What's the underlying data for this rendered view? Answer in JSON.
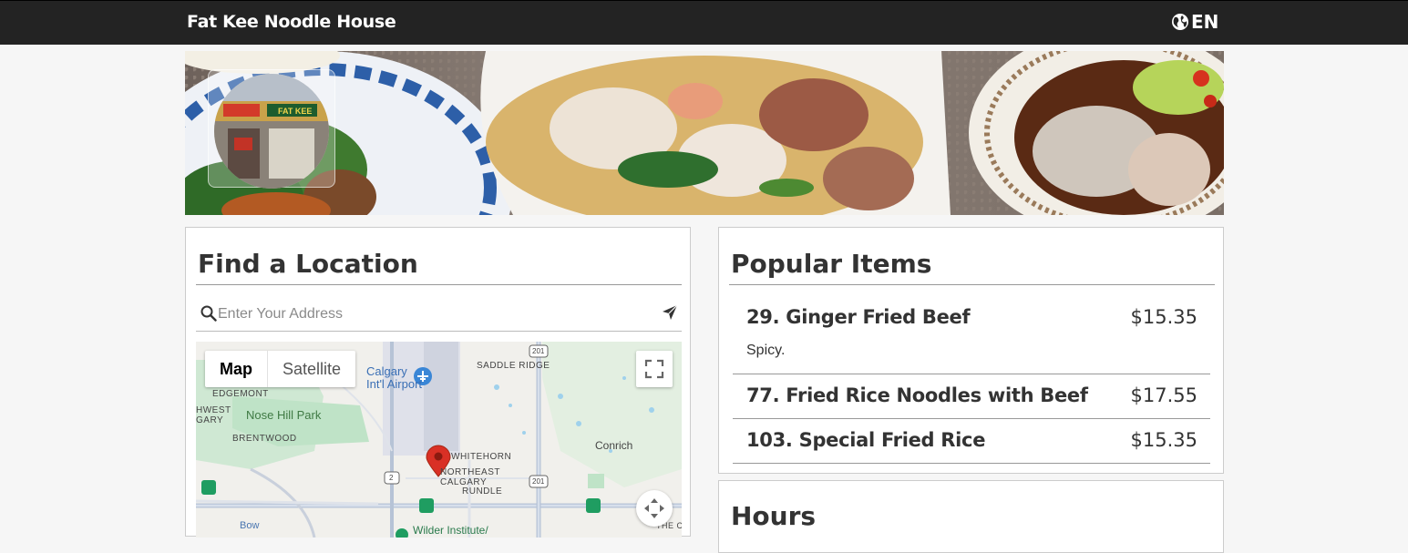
{
  "header": {
    "brand": "Fat Kee Noodle House",
    "language": "EN",
    "language_icon": "globe-icon"
  },
  "banner": {
    "logo_sign_text": "FAT KEE"
  },
  "find_location": {
    "title": "Find a Location",
    "search_placeholder": "Enter Your Address",
    "search_icon": "search-icon",
    "locate_icon": "paper-plane-icon",
    "map": {
      "type_buttons": [
        "Map",
        "Satellite"
      ],
      "selected_type": "Map",
      "labels": {
        "calgary_airport": "Calgary\nInt'l Airport",
        "saddle_ridge": "SADDLE RIDGE",
        "edgemont": "EDGEMONT",
        "hwest": "HWEST\nGARY",
        "nose_hill": "Nose Hill Park",
        "brentwood": "BRENTWOOD",
        "whitehorn": "WHITEHORN",
        "northeast": "NORTHEAST\nCALGARY",
        "rundle": "RUNDLE",
        "conrich": "Conrich",
        "hwy201_top": "201",
        "hwy201_mid": "201",
        "hwy2": "2",
        "wilder": "Wilder Institute/",
        "bottom_left": "Bow",
        "bottom_right": "THE C"
      }
    }
  },
  "popular_items": {
    "title": "Popular Items",
    "items": [
      {
        "name": "29. Ginger Fried Beef",
        "price": "$15.35",
        "description": "Spicy."
      },
      {
        "name": "77. Fried Rice Noodles with Beef",
        "price": "$17.55"
      },
      {
        "name": "103. Special Fried Rice",
        "price": "$15.35"
      }
    ]
  },
  "hours": {
    "title": "Hours"
  }
}
